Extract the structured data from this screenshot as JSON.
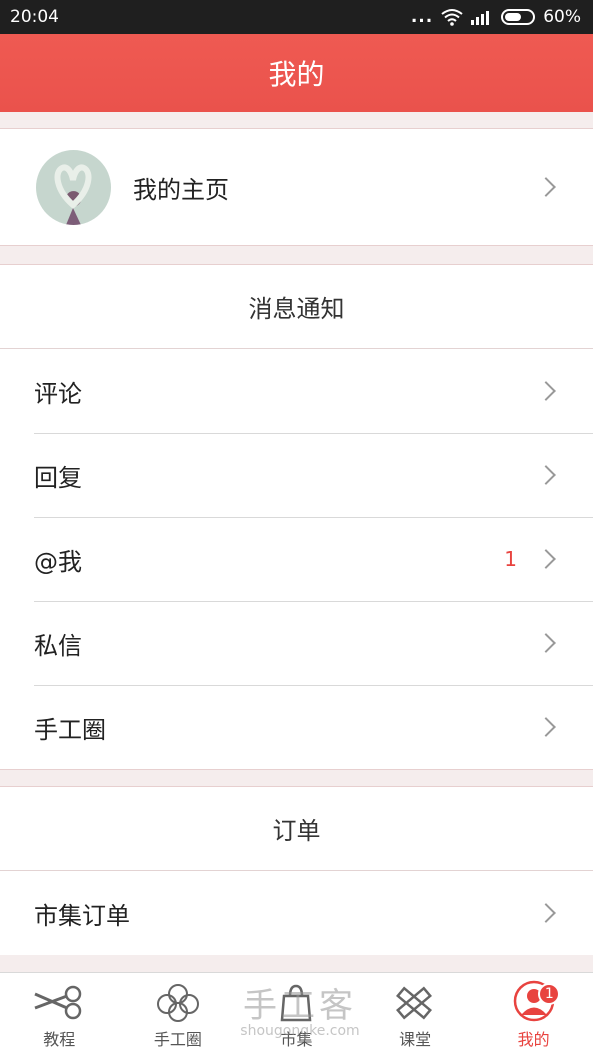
{
  "status_bar": {
    "time": "20:04",
    "dots": "...",
    "battery": "60%",
    "icons": [
      "wifi-icon",
      "signal-icon",
      "battery-icon"
    ]
  },
  "header": {
    "title": "我的"
  },
  "profile": {
    "label": "我的主页"
  },
  "messages": {
    "title": "消息通知",
    "items": [
      {
        "label": "评论",
        "count": ""
      },
      {
        "label": "回复",
        "count": ""
      },
      {
        "label": "@我",
        "count": "1"
      },
      {
        "label": "私信",
        "count": ""
      },
      {
        "label": "手工圈",
        "count": ""
      }
    ]
  },
  "orders": {
    "title": "订单",
    "items": [
      {
        "label": "市集订单"
      }
    ]
  },
  "bottom_nav": {
    "items": [
      {
        "label": "教程",
        "icon": "scissors-icon"
      },
      {
        "label": "手工圈",
        "icon": "flower-icon"
      },
      {
        "label": "市集",
        "icon": "shopping-bag-icon"
      },
      {
        "label": "课堂",
        "icon": "ruler-pencil-icon"
      },
      {
        "label": "我的",
        "icon": "user-icon",
        "badge": "1"
      }
    ]
  },
  "watermark": {
    "big": "手工客",
    "small": "shougongke.com"
  },
  "colors": {
    "accent": "#ea524c",
    "badge": "#e8433f"
  }
}
